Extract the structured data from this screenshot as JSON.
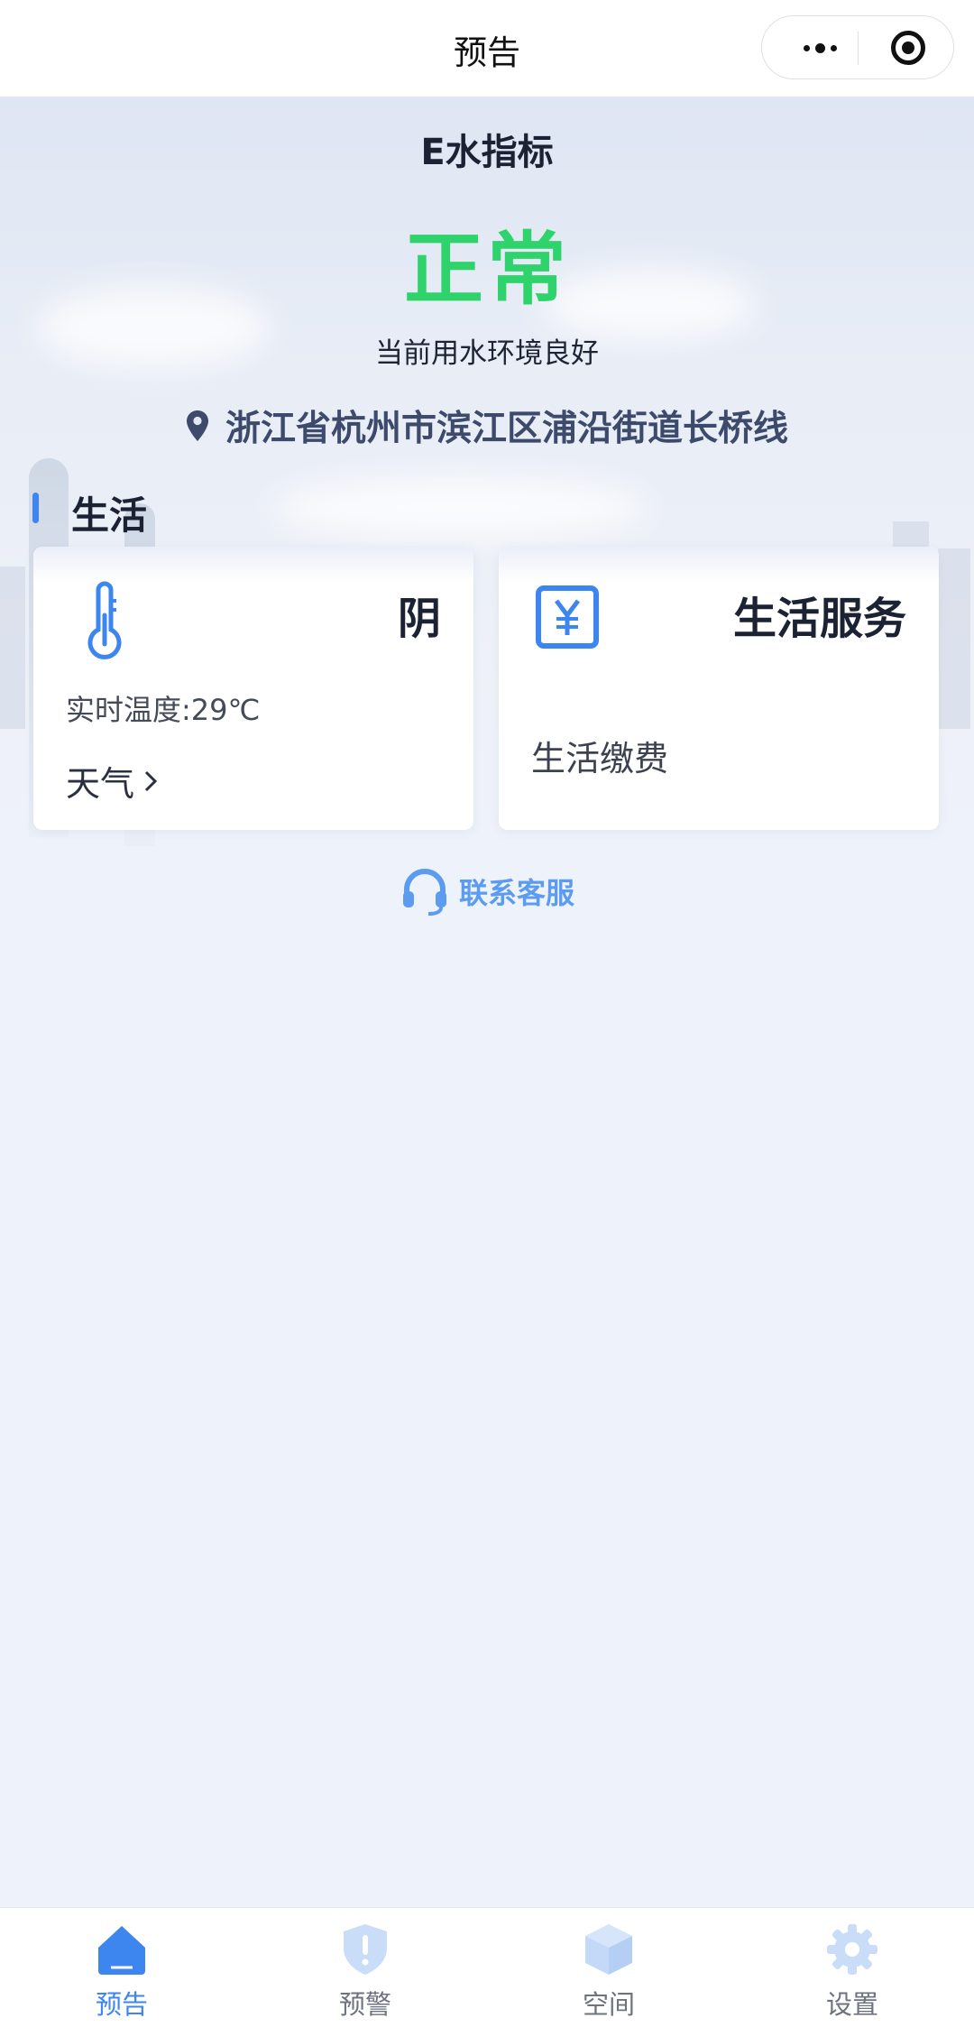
{
  "nav": {
    "title": "预告",
    "more_icon": "more-dots-icon",
    "close_icon": "target-circle-icon"
  },
  "header": {
    "metric_title": "E水指标",
    "status": "正常",
    "status_color": "#2fd36b",
    "status_desc": "当前用水环境良好",
    "location_icon": "location-pin-icon",
    "address": "浙江省杭州市滨江区浦沿街道长桥线"
  },
  "section": {
    "title": "生活",
    "accent_color": "#3d86f0"
  },
  "weather_card": {
    "icon": "thermometer-icon",
    "condition": "阴",
    "temperature": "实时温度:29℃",
    "link_label": "天气",
    "link_icon": "chevron-right-icon"
  },
  "service_card": {
    "icon": "yen-icon",
    "title": "生活服务",
    "subtitle": "生活缴费"
  },
  "contact": {
    "icon": "headset-icon",
    "label": "联系客服"
  },
  "tabs": [
    {
      "label": "预告",
      "icon": "home-icon",
      "active": true
    },
    {
      "label": "预警",
      "icon": "shield-alert-icon",
      "active": false
    },
    {
      "label": "空间",
      "icon": "cube-icon",
      "active": false
    },
    {
      "label": "设置",
      "icon": "gear-icon",
      "active": false
    }
  ]
}
